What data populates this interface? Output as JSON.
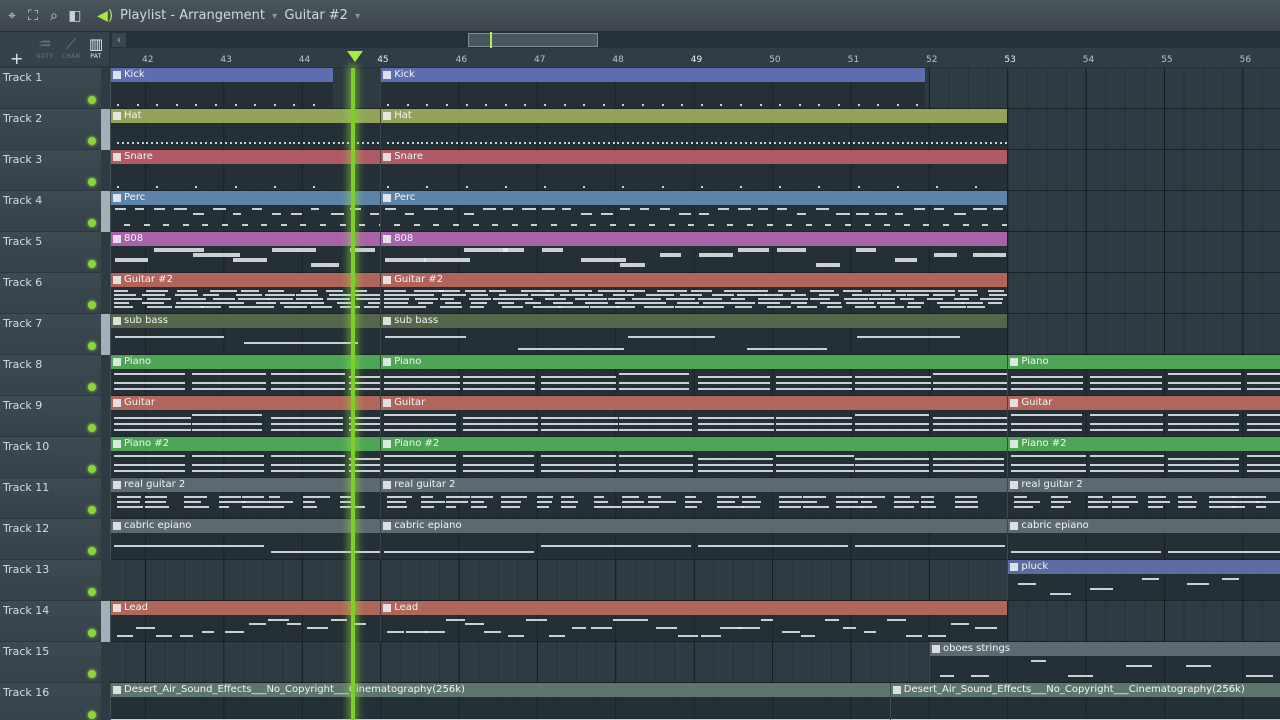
{
  "window": {
    "title_parts": [
      "Playlist",
      "Arrangement",
      "Guitar #2"
    ],
    "separator": "-"
  },
  "toolbar": {
    "tools": [
      {
        "name": "note",
        "label": "NOTE",
        "icon": "note-brush-icon",
        "active": false
      },
      {
        "name": "chan",
        "label": "CHAN",
        "icon": "channel-pen-icon",
        "active": false
      },
      {
        "name": "pat",
        "label": "PAT",
        "icon": "pattern-keys-icon",
        "active": true
      }
    ],
    "add_label": "+"
  },
  "ruler": {
    "first_bar": 42,
    "bars": [
      "42",
      "43",
      "44",
      "45",
      "46",
      "47",
      "48",
      "49",
      "50",
      "51",
      "52",
      "53",
      "54",
      "55",
      "56"
    ]
  },
  "playhead": {
    "bar": 44.65
  },
  "colors": {
    "accent": "#a9ea3f",
    "kick": "#5e6db0",
    "hat": "#93a35a",
    "snare": "#b05a66",
    "perc": "#5f83a8",
    "808": "#a961a9",
    "guitar2": "#b0645a",
    "subbass": "#56664a",
    "piano": "#4fa556",
    "guitar": "#b0665a",
    "gray": "#5d6970",
    "pluck": "#5d6ba3",
    "lead": "#b0665a",
    "audio": "#5e756e"
  },
  "tracks": [
    {
      "name": "Track 1",
      "selected": false,
      "clips": [
        {
          "label": "Kick",
          "start": 42,
          "end": 44.4,
          "color": "#5e6db0",
          "pattern": "kick"
        },
        {
          "label": "Kick",
          "start": 45,
          "end": 51.95,
          "color": "#5e6db0",
          "pattern": "kick"
        }
      ]
    },
    {
      "name": "Track 2",
      "selected": true,
      "clips": [
        {
          "label": "Hat",
          "start": 42,
          "end": 45,
          "color": "#93a35a",
          "pattern": "hat"
        },
        {
          "label": "Hat",
          "start": 45,
          "end": 53,
          "color": "#93a35a",
          "pattern": "hat"
        }
      ]
    },
    {
      "name": "Track 3",
      "selected": false,
      "clips": [
        {
          "label": "Snare",
          "start": 42,
          "end": 45,
          "color": "#b05a66",
          "pattern": "snare"
        },
        {
          "label": "Snare",
          "start": 45,
          "end": 53,
          "color": "#b05a66",
          "pattern": "snare"
        }
      ]
    },
    {
      "name": "Track 4",
      "selected": true,
      "clips": [
        {
          "label": "Perc",
          "start": 42,
          "end": 45,
          "color": "#5f83a8",
          "pattern": "perc"
        },
        {
          "label": "Perc",
          "start": 45,
          "end": 53,
          "color": "#5f83a8",
          "pattern": "perc"
        }
      ]
    },
    {
      "name": "Track 5",
      "selected": false,
      "clips": [
        {
          "label": "808",
          "start": 42,
          "end": 45,
          "color": "#a961a9",
          "pattern": "808"
        },
        {
          "label": "808",
          "start": 45,
          "end": 53,
          "color": "#a961a9",
          "pattern": "808"
        }
      ]
    },
    {
      "name": "Track 6",
      "selected": false,
      "clips": [
        {
          "label": "Guitar #2",
          "start": 42,
          "end": 45,
          "color": "#b0645a",
          "pattern": "dense"
        },
        {
          "label": "Guitar #2",
          "start": 45,
          "end": 53,
          "color": "#b0645a",
          "pattern": "dense"
        }
      ]
    },
    {
      "name": "Track 7",
      "selected": true,
      "clips": [
        {
          "label": "sub bass",
          "start": 42,
          "end": 45,
          "color": "#56664a",
          "pattern": "sub"
        },
        {
          "label": "sub bass",
          "start": 45,
          "end": 53,
          "color": "#56664a",
          "pattern": "sub"
        }
      ]
    },
    {
      "name": "Track 8",
      "selected": false,
      "clips": [
        {
          "label": "Piano",
          "start": 42,
          "end": 45,
          "color": "#4fa556",
          "pattern": "chord"
        },
        {
          "label": "Piano",
          "start": 45,
          "end": 53,
          "color": "#4fa556",
          "pattern": "chord"
        },
        {
          "label": "Piano",
          "start": 53,
          "end": 57,
          "color": "#4fa556",
          "pattern": "chord"
        }
      ]
    },
    {
      "name": "Track 9",
      "selected": false,
      "clips": [
        {
          "label": "Guitar",
          "start": 42,
          "end": 45,
          "color": "#b0665a",
          "pattern": "chord"
        },
        {
          "label": "Guitar",
          "start": 45,
          "end": 53,
          "color": "#b0665a",
          "pattern": "chord"
        },
        {
          "label": "Guitar",
          "start": 53,
          "end": 57,
          "color": "#b0665a",
          "pattern": "chord"
        }
      ]
    },
    {
      "name": "Track 10",
      "selected": false,
      "clips": [
        {
          "label": "Piano #2",
          "start": 42,
          "end": 45,
          "color": "#4fa556",
          "pattern": "chord"
        },
        {
          "label": "Piano #2",
          "start": 45,
          "end": 53,
          "color": "#4fa556",
          "pattern": "chord"
        },
        {
          "label": "Piano #2",
          "start": 53,
          "end": 57,
          "color": "#4fa556",
          "pattern": "chord"
        }
      ]
    },
    {
      "name": "Track 11",
      "selected": false,
      "clips": [
        {
          "label": "real guitar 2",
          "start": 42,
          "end": 45,
          "color": "#5d6970",
          "pattern": "stack"
        },
        {
          "label": "real guitar 2",
          "start": 45,
          "end": 53,
          "color": "#5d6970",
          "pattern": "stack"
        },
        {
          "label": "real guitar 2",
          "start": 53,
          "end": 57,
          "color": "#5d6970",
          "pattern": "stack"
        }
      ]
    },
    {
      "name": "Track 12",
      "selected": false,
      "clips": [
        {
          "label": "cabric epiano",
          "start": 42,
          "end": 45,
          "color": "#5d6970",
          "pattern": "long"
        },
        {
          "label": "cabric epiano",
          "start": 45,
          "end": 53,
          "color": "#5d6970",
          "pattern": "long"
        },
        {
          "label": "cabric epiano",
          "start": 53,
          "end": 57,
          "color": "#5d6970",
          "pattern": "long"
        }
      ]
    },
    {
      "name": "Track 13",
      "selected": false,
      "clips": [
        {
          "label": "pluck",
          "start": 53,
          "end": 57,
          "color": "#5d6ba3",
          "pattern": "sparse"
        }
      ]
    },
    {
      "name": "Track 14",
      "selected": true,
      "clips": [
        {
          "label": "Lead",
          "start": 42,
          "end": 45,
          "color": "#b0665a",
          "pattern": "melody"
        },
        {
          "label": "Lead",
          "start": 45,
          "end": 53,
          "color": "#b0665a",
          "pattern": "melody"
        }
      ]
    },
    {
      "name": "Track 15",
      "selected": false,
      "clips": [
        {
          "label": "oboes strings",
          "start": 52,
          "end": 57,
          "color": "#5d6970",
          "pattern": "sparse"
        }
      ]
    },
    {
      "name": "Track 16",
      "selected": false,
      "clips": [
        {
          "label": "Desert_Air_Sound_Effects___No_Copyright___Cinematography(256k)",
          "start": 42,
          "end": 51.5,
          "color": "#5e756e",
          "pattern": "audio"
        },
        {
          "label": "Desert_Air_Sound_Effects___No_Copyright___Cinematography(256k)",
          "start": 51.5,
          "end": 57,
          "color": "#5e756e",
          "pattern": "audio"
        }
      ]
    }
  ]
}
